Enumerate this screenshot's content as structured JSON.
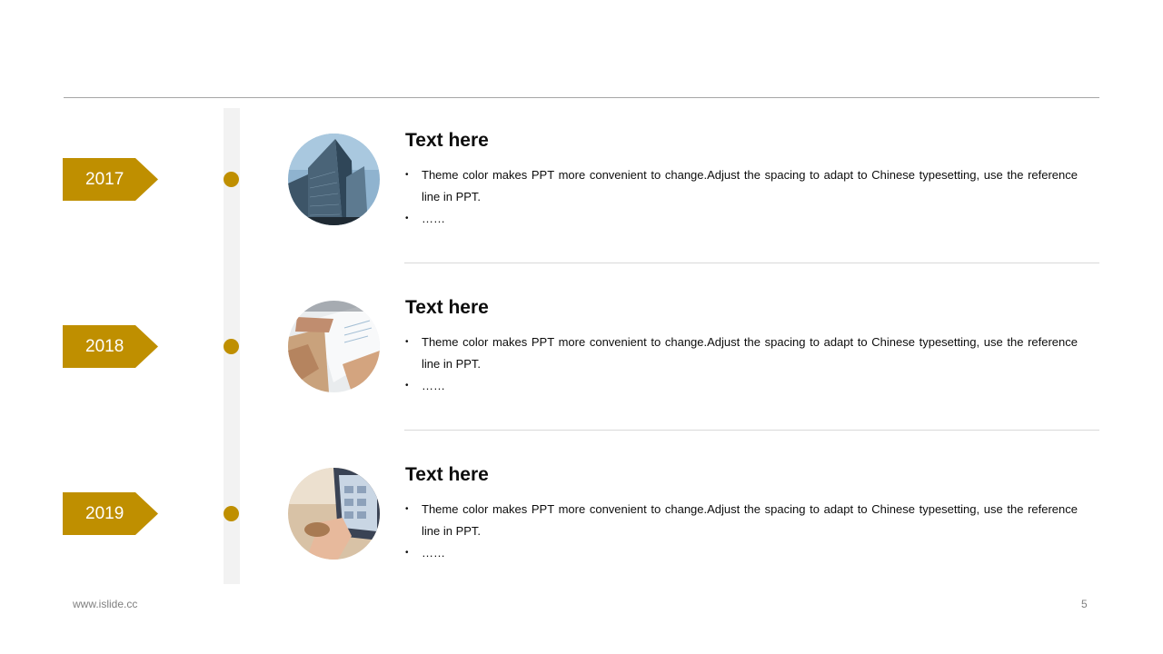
{
  "colors": {
    "accent": "#bf8f00",
    "timeline_bar": "#f2f2f2",
    "rule": "#a6a6a6",
    "separator": "#d9d9d9"
  },
  "entries": [
    {
      "year": "2017",
      "image": "office-buildings-photo",
      "title": "Text here",
      "bullets": [
        "Theme color makes PPT more convenient to change.Adjust the spacing to adapt to Chinese typesetting, use the reference line in PPT.",
        "……"
      ]
    },
    {
      "year": "2018",
      "image": "meeting-documents-photo",
      "title": "Text here",
      "bullets": [
        "Theme color makes PPT more convenient to change.Adjust the spacing to adapt to Chinese typesetting, use the reference line in PPT.",
        "……"
      ]
    },
    {
      "year": "2019",
      "image": "tablet-hands-photo",
      "title": "Text here",
      "bullets": [
        "Theme color makes PPT more convenient to change.Adjust the spacing to adapt to Chinese typesetting, use the reference line in PPT.",
        "……"
      ]
    }
  ],
  "footer": {
    "url": "www.islide.cc",
    "page": "5"
  }
}
